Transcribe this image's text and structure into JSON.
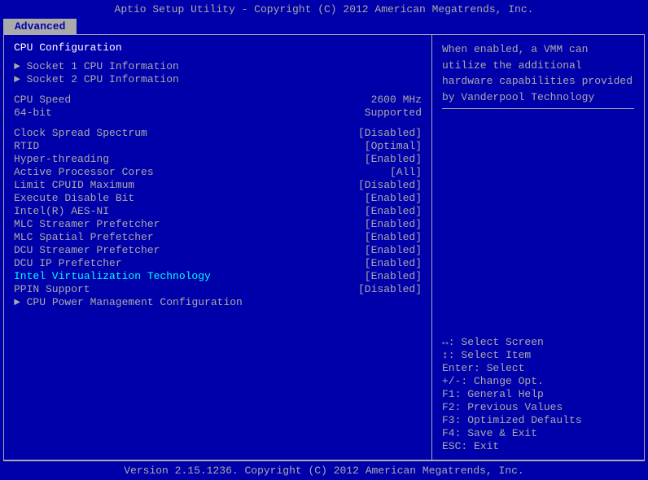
{
  "title": "Aptio Setup Utility - Copyright (C) 2012 American Megatrends, Inc.",
  "tab": "Advanced",
  "left": {
    "section_title": "CPU Configuration",
    "items": [
      {
        "type": "arrow",
        "label": "Socket 1 CPU Information",
        "value": ""
      },
      {
        "type": "arrow",
        "label": "Socket 2 CPU Information",
        "value": ""
      },
      {
        "type": "spacer"
      },
      {
        "type": "plain",
        "label": "CPU Speed",
        "value": "2600 MHz"
      },
      {
        "type": "plain",
        "label": "64-bit",
        "value": "Supported"
      },
      {
        "type": "spacer"
      },
      {
        "type": "option",
        "label": "Clock Spread Spectrum",
        "value": "[Disabled]"
      },
      {
        "type": "option",
        "label": "RTID",
        "value": "[Optimal]"
      },
      {
        "type": "option",
        "label": "Hyper-threading",
        "value": "[Enabled]"
      },
      {
        "type": "option",
        "label": "Active Processor Cores",
        "value": "[All]"
      },
      {
        "type": "option",
        "label": "Limit CPUID Maximum",
        "value": "[Disabled]"
      },
      {
        "type": "option",
        "label": "Execute Disable Bit",
        "value": "[Enabled]"
      },
      {
        "type": "option",
        "label": "Intel(R) AES-NI",
        "value": "[Enabled]"
      },
      {
        "type": "option",
        "label": "MLC Streamer Prefetcher",
        "value": "[Enabled]"
      },
      {
        "type": "option",
        "label": "MLC Spatial Prefetcher",
        "value": "[Enabled]"
      },
      {
        "type": "option",
        "label": "DCU Streamer Prefetcher",
        "value": "[Enabled]"
      },
      {
        "type": "option",
        "label": "DCU IP Prefetcher",
        "value": "[Enabled]"
      },
      {
        "type": "option",
        "label": "Intel Virtualization Technology",
        "value": "[Enabled]",
        "highlight": true
      },
      {
        "type": "option",
        "label": "PPIN Support",
        "value": "[Disabled]"
      },
      {
        "type": "arrow",
        "label": "CPU Power Management Configuration",
        "value": ""
      }
    ]
  },
  "right": {
    "info_text": "When enabled, a VMM can utilize the additional hardware capabilities provided by Vanderpool Technology",
    "help": [
      {
        "keys": "↔:",
        "desc": "Select Screen"
      },
      {
        "keys": "↕:",
        "desc": "Select Item"
      },
      {
        "keys": "Enter:",
        "desc": "Select"
      },
      {
        "keys": "+/-:",
        "desc": "Change Opt."
      },
      {
        "keys": "F1:",
        "desc": "General Help"
      },
      {
        "keys": "F2:",
        "desc": "Previous Values"
      },
      {
        "keys": "F3:",
        "desc": "Optimized Defaults"
      },
      {
        "keys": "F4:",
        "desc": "Save & Exit"
      },
      {
        "keys": "ESC:",
        "desc": "Exit"
      }
    ]
  },
  "footer": "Version 2.15.1236. Copyright (C) 2012 American Megatrends, Inc."
}
